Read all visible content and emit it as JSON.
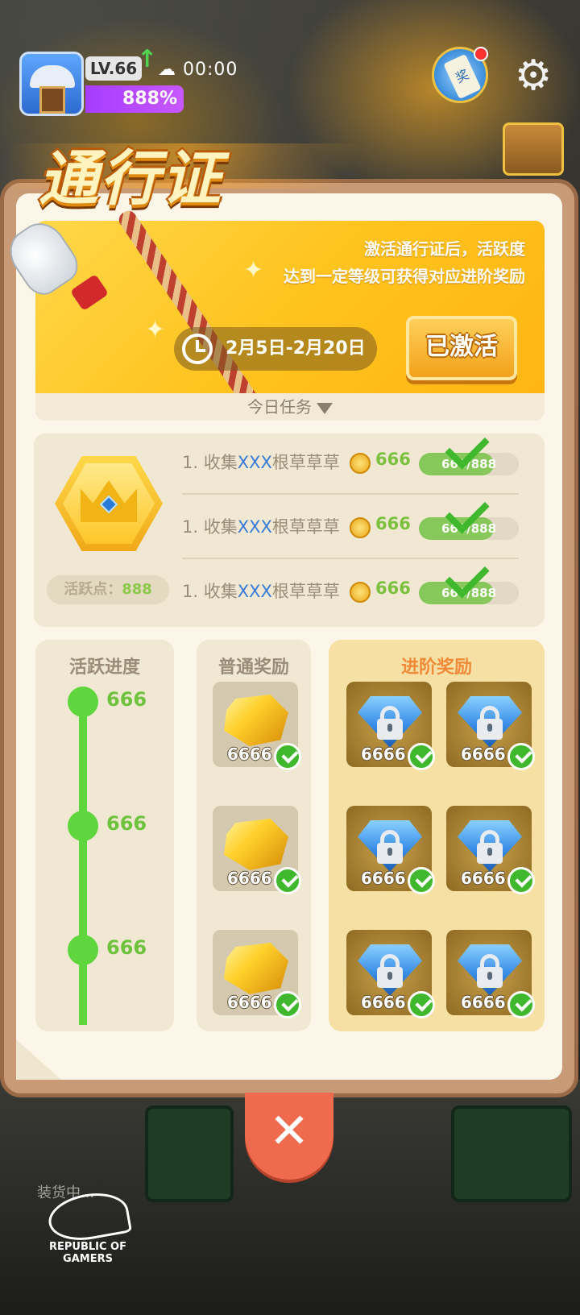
{
  "hud": {
    "level": "LV.66",
    "timer": "00:00",
    "percent": "888%",
    "scroll_char": "奖"
  },
  "pass": {
    "title": "通行证",
    "desc_line1": "激活通行证后，活跃度",
    "desc_line2": "达到一定等级可获得对应进阶奖励",
    "date_range": "2月5日-2月20日",
    "activated_label": "已激活",
    "today_tasks_label": "今日任务"
  },
  "tasks": {
    "activity_label": "活跃点：",
    "activity_value": "888",
    "rows": [
      {
        "prefix": "1. 收集",
        "highlight": "XXX",
        "suffix": "根草草草",
        "reward": "666",
        "progress_text": "666/888",
        "progress": 0.75
      },
      {
        "prefix": "1. 收集",
        "highlight": "XXX",
        "suffix": "根草草草",
        "reward": "666",
        "progress_text": "666/888",
        "progress": 0.75
      },
      {
        "prefix": "1. 收集",
        "highlight": "XXX",
        "suffix": "根草草草",
        "reward": "666",
        "progress_text": "666/888",
        "progress": 0.75
      }
    ]
  },
  "columns": {
    "progress_title": "活跃进度",
    "normal_title": "普通奖励",
    "advanced_title": "进阶奖励"
  },
  "progress_nodes": [
    "666",
    "666",
    "666"
  ],
  "normal_rewards": [
    "6666",
    "6666",
    "6666"
  ],
  "advanced_rewards": [
    "6666",
    "6666",
    "6666",
    "6666",
    "6666",
    "6666"
  ],
  "bottom": {
    "loading_text": "装货中...",
    "brand_line1": "REPUBLIC OF",
    "brand_line2": "GAMERS"
  },
  "colors": {
    "banner": "#ffc31e",
    "accent_green": "#5fd63e",
    "advanced_orange": "#f08a38",
    "close_red": "#f06a4e"
  }
}
